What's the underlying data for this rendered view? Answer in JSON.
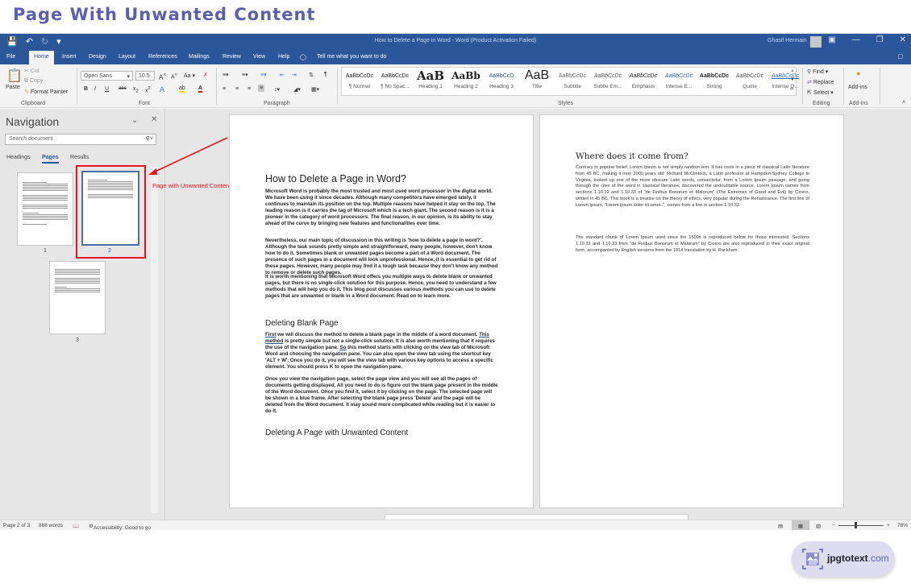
{
  "banner": {
    "title": "Page With Unwanted Content"
  },
  "titlebar": {
    "doc_title": "How to Delete a Page in Word  -  Word (Product Activation Failed)",
    "user": "Ghasif Hermain"
  },
  "tabs": [
    "File",
    "Home",
    "Insert",
    "Design",
    "Layout",
    "References",
    "Mailings",
    "Review",
    "View",
    "Help"
  ],
  "tell_me": "Tell me what you want to do",
  "ribbon": {
    "clipboard": {
      "paste": "Paste",
      "cut": "Cut",
      "copy": "Copy",
      "format_painter": "Format Painter",
      "label": "Clipboard"
    },
    "font": {
      "name": "Open Sans",
      "size": "10.5",
      "label": "Font",
      "case_btn": "Aa"
    },
    "paragraph": {
      "label": "Paragraph"
    },
    "styles": {
      "label": "Styles",
      "items": [
        {
          "preview": "AaBbCcDc",
          "name": "¶ Normal"
        },
        {
          "preview": "AaBbCcDc",
          "name": "¶ No Spac..."
        },
        {
          "preview": "AaB",
          "name": "Heading 1"
        },
        {
          "preview": "AaBb",
          "name": "Heading 2"
        },
        {
          "preview": "AaBbCcD",
          "name": "Heading 3"
        },
        {
          "preview": "AaB",
          "name": "Title"
        },
        {
          "preview": "AaBbCcDc",
          "name": "Subtitle"
        },
        {
          "preview": "AaBbCcDc",
          "name": "Subtle Em..."
        },
        {
          "preview": "AaBbCcDc",
          "name": "Emphasis"
        },
        {
          "preview": "AaBbCcDc",
          "name": "Intense E..."
        },
        {
          "preview": "AaBbCcDc",
          "name": "Strong"
        },
        {
          "preview": "AaBbCcDc",
          "name": "Quote"
        },
        {
          "preview": "AaBbCcDc",
          "name": "Intense Q..."
        }
      ]
    },
    "editing": {
      "find": "Find",
      "replace": "Replace",
      "select": "Select",
      "label": "Editing"
    },
    "addins": {
      "button": "Add-ins",
      "label": "Add-ins"
    }
  },
  "navigation": {
    "title": "Navigation",
    "search_placeholder": "Search document",
    "tabs": [
      "Headings",
      "Pages",
      "Results"
    ],
    "active_tab": "Pages",
    "pages": [
      "1",
      "2",
      "3"
    ],
    "selected_page": "2",
    "annotation": "Page with Unwanted Content."
  },
  "page1": {
    "heading": "How to Delete a Page in Word?",
    "p1": "Microsoft Word is probably the most trusted and most used word processor in the digital world. We have been using it since decades. Although many competitors have emerged lately, it continues to maintain its position on the top. Multiple reasons have helped it stay on the top. The leading reason is it carries the tag of Microsoft which is a tech giant. The second reason is it is a pioneer in the category of word processors. The final reason, in our opinion, is its ability to stay ahead of the curve by bringing new features and functionalities over time.",
    "p2": "Nevertheless, our main topic of discussion in this writing is 'how to delete a page in word?'. Although the task sounds pretty simple and straightforward, many people, however, don't know how to do it. Sometimes blank or unwanted pages become a part of a Word document. The presence of such pages in a document will look unprofessional. Hence, it is essential to get rid of these pages. However, many people may find it a tough task because they don't know any method to remove or delete such pages.",
    "p3": "It is worth mentioning that Microsoft Word offers you multiple ways to delete blank or unwanted pages, but there is no single-click solution for this purpose. Hence, you need to understand a few methods that will help you do it. This blog post discusses various methods you can use to delete pages that are unwanted or blank in a Word document. Read on to learn more.",
    "h2a": "Deleting Blank Page",
    "p4_first": "First",
    "p4_a": " we will discuss the method to delete a blank page in the middle of a word document. ",
    "p4_this": "This  method",
    "p4_b": " is pretty simple but not a single-click solution. It is also worth mentioning that it requires the use of the navigation pane. ",
    "p4_so": "So",
    "p4_c": " this method starts with clicking on the view tab of Microsoft Word and choosing the navigation pane. You can also open the view tab using the shortcut key 'ALT + W'. Once you do it, you will see the view tab with various key options to access a specific element. You should press K to open the navigation pane.",
    "p5": "Once you view the navigation page, select the page view and you will see all the pages of documents getting displayed. All you need to do is figure out the blank page present in the middle of the Word document. Once you find it, select it by clicking on the page. The selected page will be shown in a blue frame. After selecting the blank page press 'Delete' and the page will be deleted from the Word document. It may sound more complicated while reading but it is easier to do it.",
    "h2b": "Deleting A Page with Unwanted Content"
  },
  "page2": {
    "heading": "Where does it come from?",
    "p1": "Contrary to popular belief, Lorem Ipsum is not simply random text. It has roots in a piece of classical Latin literature from 45 BC, making it over 2000 years old. Richard McClintock, a Latin professor at Hampden-Sydney College in Virginia, looked up one of the more obscure Latin words, consectetur, from a Lorem Ipsum passage, and going through the cites of the word in classical literature, discovered the undoubtable source. Lorem Ipsum comes from sections 1.10.32 and 1.10.33 of \"de Finibus Bonorum et Malorum\" (The Extremes of Good and Evil) by Cicero, written in 45 BC. This book is a treatise on the theory of ethics, very popular during the Renaissance. The first line of Lorem Ipsum, \"Lorem ipsum dolor sit amet..\", comes from a line in section 1.10.32.",
    "p2": "The standard chunk of Lorem Ipsum used since the 1500s is reproduced below for those interested. Sections 1.10.32 and 1.10.33 from \"de Finibus Bonorum et Malorum\" by Cicero are also reproduced in their exact original form, accompanied by English versions from the 1914 translation by H. Rackham."
  },
  "status": {
    "page": "Page 2 of 3",
    "words": "888 words",
    "accessibility": "Accessibility: Good to go",
    "zoom": "78%",
    "zoom_minus": "−",
    "zoom_plus": "+"
  },
  "watermark": {
    "name": "jpgtotext",
    "domain": ".com"
  },
  "colors": {
    "word_blue": "#2b579a",
    "annotation_red": "#e8141c",
    "banner_text": "#5a5fb0"
  }
}
